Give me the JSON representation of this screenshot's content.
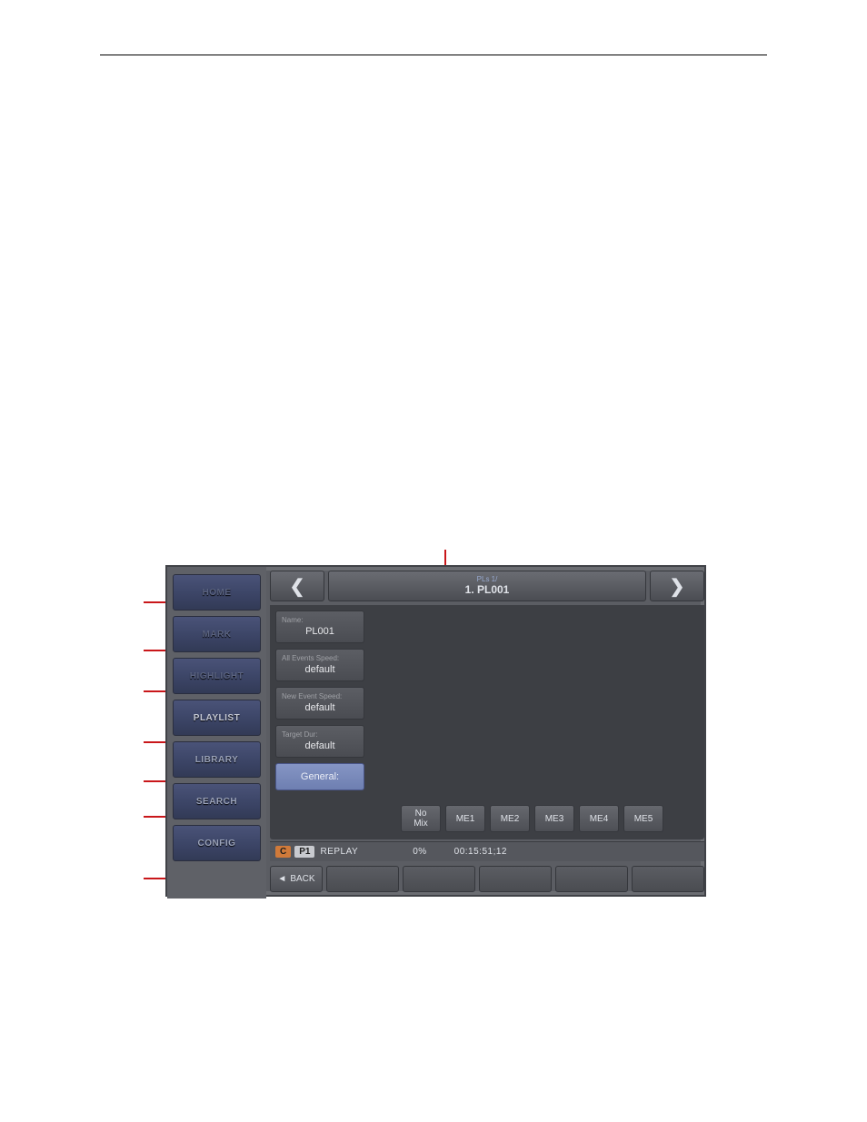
{
  "header": {
    "crumb": "PLs 1/",
    "title": "1. PL001"
  },
  "sidebar": {
    "items": [
      {
        "label": "HOME"
      },
      {
        "label": "MARK"
      },
      {
        "label": "HIGHLIGHT"
      },
      {
        "label": "PLAYLIST"
      },
      {
        "label": "LIBRARY"
      },
      {
        "label": "SEARCH"
      },
      {
        "label": "CONFIG"
      }
    ]
  },
  "fields": {
    "name": {
      "label": "Name:",
      "value": "PL001"
    },
    "all_speed": {
      "label": "All Events Speed:",
      "value": "default"
    },
    "new_speed": {
      "label": "New Event Speed:",
      "value": "default"
    },
    "target_dur": {
      "label": "Target Dur:",
      "value": "default"
    }
  },
  "general_label": "General:",
  "me_buttons": [
    "No\nMix",
    "ME1",
    "ME2",
    "ME3",
    "ME4",
    "ME5"
  ],
  "status": {
    "c": "C",
    "p1": "P1",
    "replay": "REPLAY",
    "pct": "0%",
    "tc": "00:15:51;12"
  },
  "footer": {
    "back": "BACK"
  }
}
